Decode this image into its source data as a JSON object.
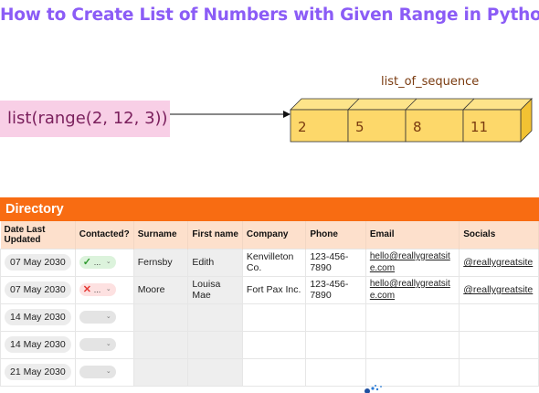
{
  "title": "How to Create List of Numbers with Given Range in Python",
  "code": "list(range(2, 12, 3))",
  "sequence_label": "list_of_sequence",
  "sequence": [
    "2",
    "5",
    "8",
    "11"
  ],
  "directory": {
    "title": "Directory",
    "columns": [
      "Date Last Updated",
      "Contacted?",
      "Surname",
      "First name",
      "Company",
      "Phone",
      "Email",
      "Socials"
    ],
    "rows": [
      {
        "date": "07 May 2030",
        "contacted": "yes",
        "contacted_text": "...",
        "surname": "Fernsby",
        "first": "Edith",
        "company": "Kenvilleton Co.",
        "phone": "123-456-7890",
        "email": "hello@reallygreatsite.com",
        "socials": "@reallygreatsite"
      },
      {
        "date": "07 May 2030",
        "contacted": "no",
        "contacted_text": "...",
        "surname": "Moore",
        "first": "Louisa Mae",
        "company": "Fort Pax Inc.",
        "phone": "123-456-7890",
        "email": "hello@reallygreatsite.com",
        "socials": "@reallygreatsite"
      },
      {
        "date": "14 May 2030",
        "contacted": "empty",
        "contacted_text": "",
        "surname": "",
        "first": "",
        "company": "",
        "phone": "",
        "email": "",
        "socials": ""
      },
      {
        "date": "14 May 2030",
        "contacted": "empty",
        "contacted_text": "",
        "surname": "",
        "first": "",
        "company": "",
        "phone": "",
        "email": "",
        "socials": ""
      },
      {
        "date": "21 May 2030",
        "contacted": "empty",
        "contacted_text": "",
        "surname": "",
        "first": "",
        "company": "",
        "phone": "",
        "email": "",
        "socials": ""
      }
    ]
  },
  "colors": {
    "title": "#8b5cf6",
    "directory_bar": "#f86c12",
    "cube_fill": "#fdd86a"
  }
}
